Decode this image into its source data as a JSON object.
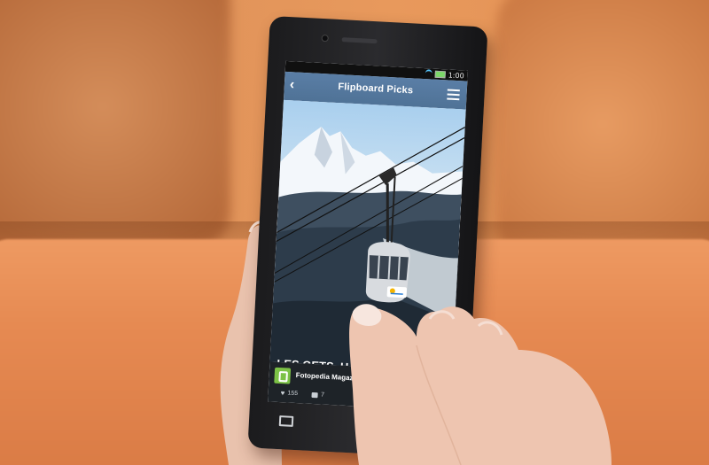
{
  "app": {
    "title": "Flipboard Picks",
    "clock": "1:00"
  },
  "article": {
    "headline": "LES GETS, HAUTE",
    "source_name": "Fotopedia Magazine",
    "likes": "155",
    "comments": "7",
    "badge_text": "les gets"
  },
  "icons": {
    "back": "chevron-left-icon",
    "menu": "hamburger-menu-icon",
    "like": "heart-icon",
    "comment": "comment-icon",
    "add": "plus-icon",
    "recent_apps": "recent-apps-icon"
  },
  "colors": {
    "topbar": "#5a7ea6",
    "footer": "#1e2328",
    "source_logo": "#7cc246",
    "couch": "#e68a52"
  }
}
